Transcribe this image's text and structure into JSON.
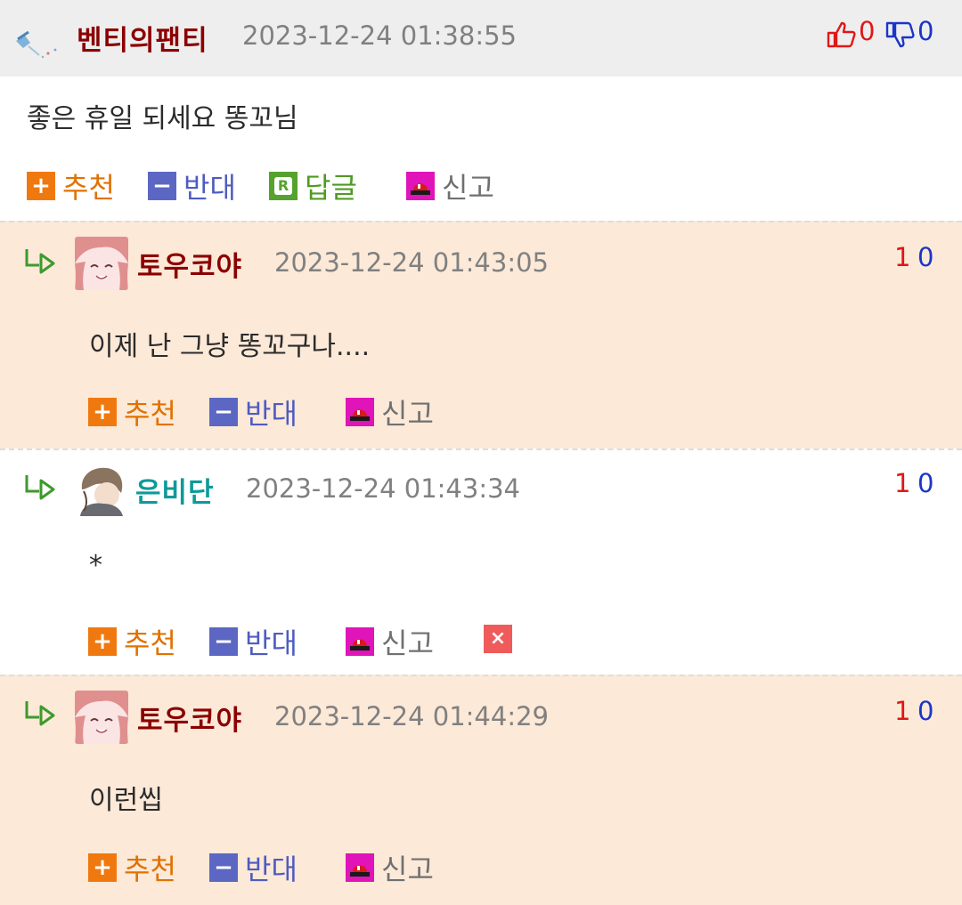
{
  "comments": [
    {
      "nick": "벤티의팬티",
      "time": "2023-12-24 01:38:55",
      "up": "0",
      "down": "0",
      "text": "좋은 휴일 되세요 똥꼬님",
      "actions": {
        "recommend": "추천",
        "oppose": "반대",
        "reply": "답글",
        "report": "신고"
      }
    },
    {
      "nick": "토우코야",
      "time": "2023-12-24 01:43:05",
      "up": "1",
      "down": "0",
      "text": "이제 난 그냥 똥꼬구나....",
      "actions": {
        "recommend": "추천",
        "oppose": "반대",
        "report": "신고"
      }
    },
    {
      "nick": "은비단",
      "time": "2023-12-24 01:43:34",
      "up": "1",
      "down": "0",
      "text": "*",
      "actions": {
        "recommend": "추천",
        "oppose": "반대",
        "report": "신고"
      }
    },
    {
      "nick": "토우코야",
      "time": "2023-12-24 01:44:29",
      "up": "1",
      "down": "0",
      "text": "이런씹",
      "actions": {
        "recommend": "추천",
        "oppose": "반대",
        "report": "신고"
      }
    }
  ],
  "icons": {
    "plus": "+",
    "minus": "−",
    "reply": "R",
    "delete": "×"
  },
  "colors": {
    "highlight_bg": "#fce9d8",
    "header_bg": "#eeeeee",
    "nick": "#8b0000",
    "nick_alt": "#0e9a9a",
    "up": "#e01818",
    "down": "#1a36c8"
  }
}
